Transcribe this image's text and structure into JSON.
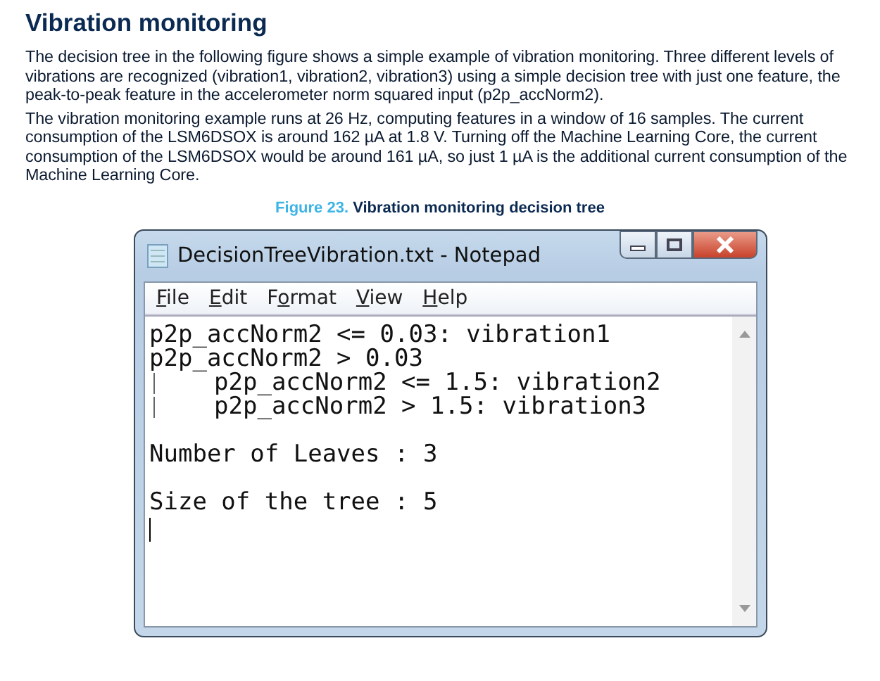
{
  "heading": "Vibration monitoring",
  "paragraphs": [
    "The decision tree in the following figure shows a simple example of vibration monitoring. Three different levels of vibrations are recognized (vibration1, vibration2, vibration3) using a simple decision tree with just one feature, the peak-to-peak feature in the accelerometer norm squared input (p2p_accNorm2).",
    "The vibration monitoring example runs at 26 Hz, computing features in a window of 16 samples. The current consumption of the LSM6DSOX is around 162 µA at 1.8 V. Turning off the Machine Learning Core, the current consumption of the LSM6DSOX would be around 161 µA, so just 1 µA is the additional current consumption of the Machine Learning Core."
  ],
  "figure": {
    "number": "Figure 23.",
    "caption": "Vibration monitoring decision tree"
  },
  "window": {
    "title": "DecisionTreeVibration.txt - Notepad",
    "menu": [
      {
        "key": "F",
        "after": "ile"
      },
      {
        "key": "E",
        "after": "dit"
      },
      {
        "before": "F",
        "key": "o",
        "after": "rmat"
      },
      {
        "key": "V",
        "after": "iew"
      },
      {
        "key": "H",
        "after": "elp"
      }
    ],
    "tree": [
      {
        "text": "p2p_accNorm2 <= 0.03: vibration1"
      },
      {
        "text": "p2p_accNorm2 > 0.03",
        "children": [
          {
            "text": "p2p_accNorm2 <= 1.5: vibration2"
          },
          {
            "text": "p2p_accNorm2 > 1.5: vibration3"
          }
        ]
      }
    ],
    "summary": [
      "Number of Leaves : 3",
      "Size of the tree : 5"
    ]
  }
}
